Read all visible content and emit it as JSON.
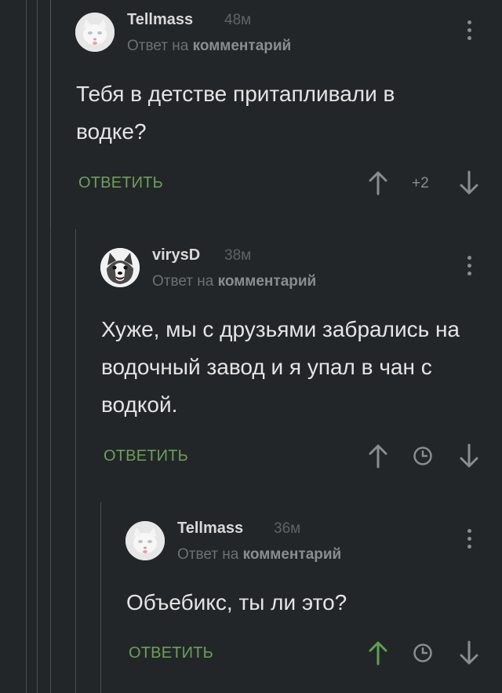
{
  "comments": [
    {
      "username": "Tellmass",
      "time": "48м",
      "reply_prefix": "Ответ на",
      "reply_link": "комментарий",
      "text": "Тебя в детстве притапливали в водке?",
      "reply_label": "ОТВЕТИТЬ",
      "rating": "+2"
    },
    {
      "username": "virysD",
      "time": "38м",
      "reply_prefix": "Ответ на",
      "reply_link": "комментарий",
      "text": "Хуже, мы с друзьями забрались на водочный завод и я упал в чан с водкой.",
      "reply_label": "ОТВЕТИТЬ"
    },
    {
      "username": "Tellmass",
      "time": "36м",
      "reply_prefix": "Ответ на",
      "reply_link": "комментарий",
      "text": "Объебикс, ты ли это?",
      "reply_label": "ОТВЕТИТЬ"
    }
  ],
  "colors": {
    "background": "#232629",
    "accent_green": "#6aa05a",
    "upvoted_green": "#5da24f",
    "icon_gray": "#8a8d90"
  },
  "icons": [
    "avatar-cat",
    "avatar-husky",
    "more-vertical-icon",
    "upvote-arrow-icon",
    "downvote-arrow-icon",
    "clock-icon"
  ]
}
